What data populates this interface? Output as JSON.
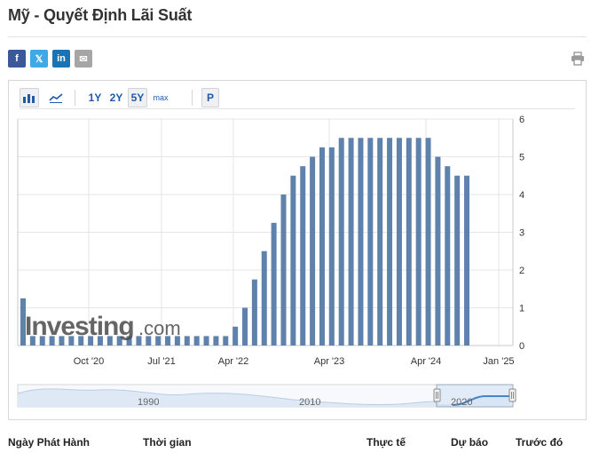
{
  "page": {
    "title": "Mỹ - Quyết Định Lãi Suất"
  },
  "share": [
    {
      "name": "facebook",
      "glyph": "f",
      "color": "#3b5998"
    },
    {
      "name": "twitter",
      "glyph": "𝕏",
      "color": "#3fa9e8"
    },
    {
      "name": "linkedin",
      "glyph": "in",
      "color": "#1a74b4"
    },
    {
      "name": "email",
      "glyph": "✉",
      "color": "#a6a6a6"
    }
  ],
  "toolbar": {
    "ranges": [
      {
        "label": "1Y",
        "active": false
      },
      {
        "label": "2Y",
        "active": false
      },
      {
        "label": "5Y",
        "active": true
      },
      {
        "label": "max",
        "active": false
      }
    ],
    "p_label": "P"
  },
  "chart_data": {
    "type": "bar",
    "values": [
      1.25,
      0.25,
      0.25,
      0.25,
      0.25,
      0.25,
      0.25,
      0.25,
      0.25,
      0.25,
      0.25,
      0.25,
      0.25,
      0.25,
      0.25,
      0.25,
      0.25,
      0.25,
      0.25,
      0.25,
      0.25,
      0.25,
      0.5,
      1.0,
      1.75,
      2.5,
      3.25,
      4.0,
      4.5,
      4.75,
      5.0,
      5.25,
      5.25,
      5.5,
      5.5,
      5.5,
      5.5,
      5.5,
      5.5,
      5.5,
      5.5,
      5.5,
      5.5,
      5.0,
      4.75,
      4.5,
      4.5
    ],
    "x_tick_labels": [
      "Oct '20",
      "Jul '21",
      "Apr '22",
      "Apr '23",
      "Apr '24",
      "Jan '25"
    ],
    "y_ticks": [
      0,
      1,
      2,
      3,
      4,
      5,
      6
    ],
    "ylim": [
      0,
      6
    ],
    "bar_color": "#5f82ad",
    "watermark_color": "#4a4a4a",
    "grid": true
  },
  "watermark": {
    "text": "Investing",
    "suffix": ".com"
  },
  "navigator": {
    "labels": [
      "1990",
      "2010",
      "2020"
    ],
    "series_color": "#4a86c5",
    "fill_color": "#dfe9f5"
  },
  "table_header": {
    "release_date": "Ngày Phát Hành",
    "time": "Thời gian",
    "actual": "Thực tế",
    "forecast": "Dự báo",
    "previous": "Trước đó"
  }
}
